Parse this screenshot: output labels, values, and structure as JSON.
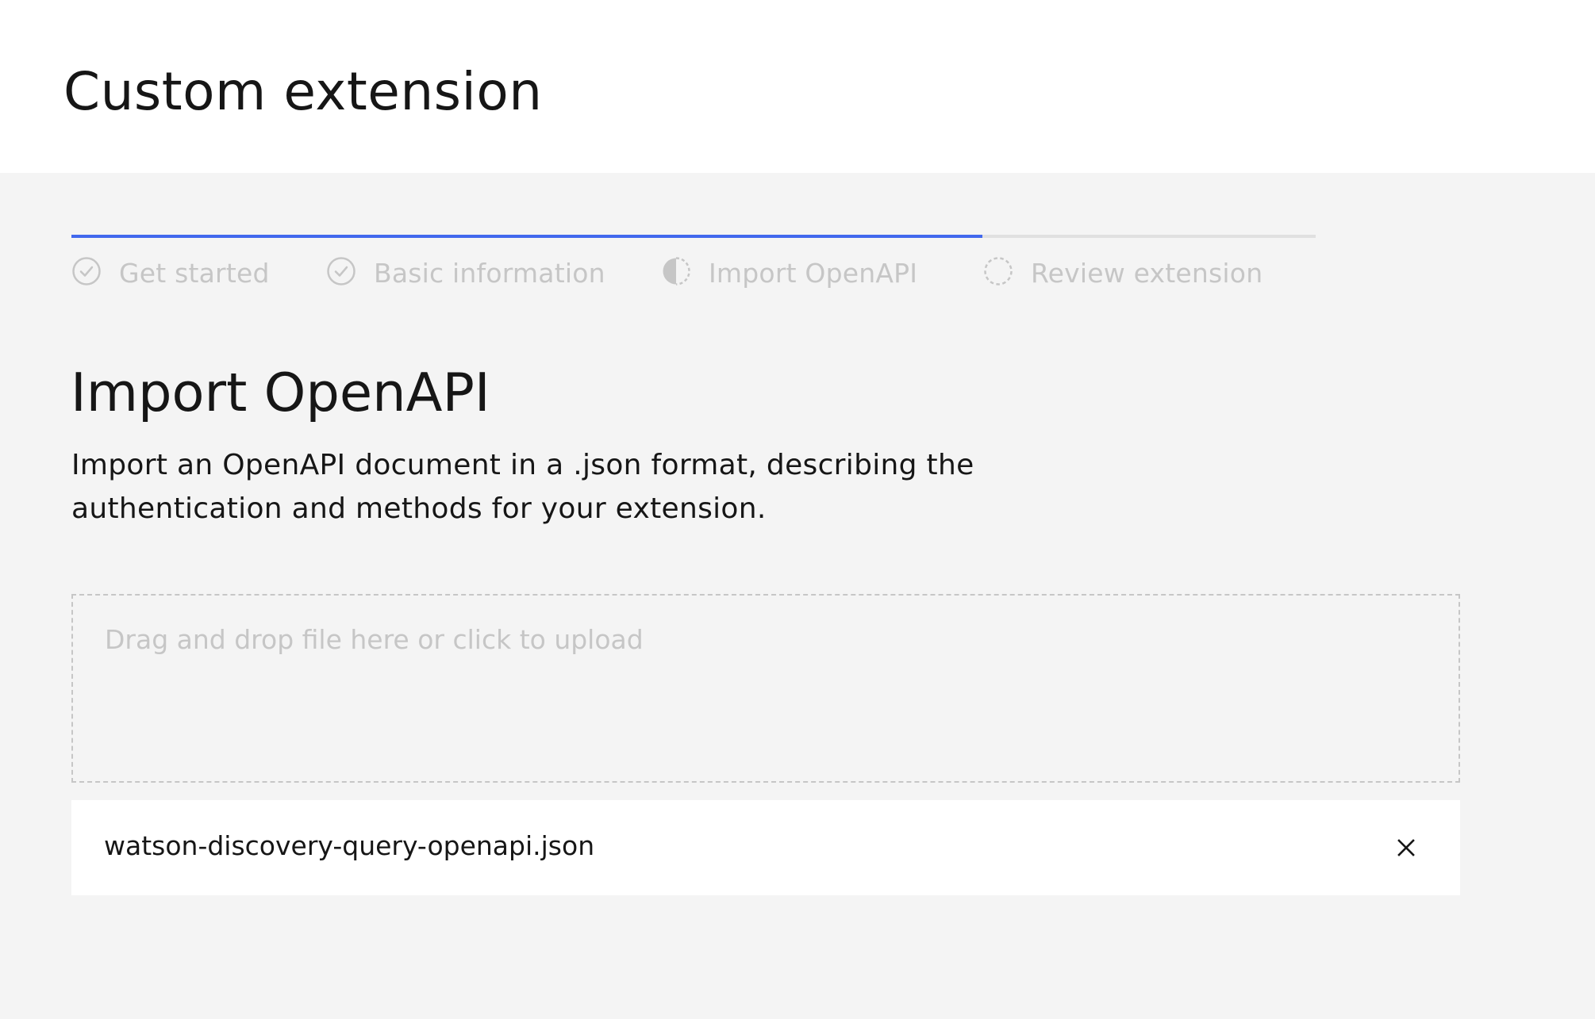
{
  "header": {
    "title": "Custom extension"
  },
  "progress": {
    "completed_fraction": 0.732,
    "steps": [
      {
        "label": "Get started",
        "status": "complete",
        "icon": "checkmark-circle-icon"
      },
      {
        "label": "Basic information",
        "status": "complete",
        "icon": "checkmark-circle-icon"
      },
      {
        "label": "Import OpenAPI",
        "status": "current",
        "icon": "half-circle-icon"
      },
      {
        "label": "Review extension",
        "status": "incomplete",
        "icon": "dashed-circle-icon"
      }
    ]
  },
  "content": {
    "title": "Import OpenAPI",
    "description": "Import an OpenAPI document in a .json format, describing the authentication and methods for your extension."
  },
  "upload": {
    "dropzone_text": "Drag and drop file here or click to upload",
    "file_name": "watson-discovery-query-openapi.json",
    "remove_icon": "close-icon"
  },
  "colors": {
    "accent": "#4168ed",
    "background": "#f4f4f4",
    "muted_text": "#c6c6c6",
    "text": "#161616"
  }
}
